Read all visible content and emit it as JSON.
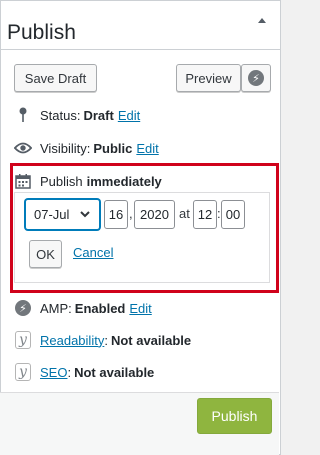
{
  "panel": {
    "title": "Publish"
  },
  "actions": {
    "save_draft": "Save Draft",
    "preview": "Preview"
  },
  "status": {
    "label": "Status:",
    "value": "Draft",
    "edit": "Edit"
  },
  "visibility": {
    "label": "Visibility:",
    "value": "Public",
    "edit": "Edit"
  },
  "schedule": {
    "label": "Publish",
    "value": "immediately",
    "month": "07-Jul",
    "day": "16",
    "comma": ",",
    "year": "2020",
    "at": "at",
    "hour": "12",
    "colon": ":",
    "minute": "00",
    "ok": "OK",
    "cancel": "Cancel"
  },
  "amp": {
    "label": "AMP:",
    "value": "Enabled",
    "edit": "Edit"
  },
  "readability": {
    "link": "Readability",
    "suffix": ":",
    "value": "Not available"
  },
  "seo": {
    "link": "SEO",
    "suffix": ":",
    "value": "Not available"
  },
  "footer": {
    "publish": "Publish"
  },
  "colors": {
    "link": "#0073aa",
    "highlight": "#d0021b",
    "publish_button": "#8fb53f"
  }
}
